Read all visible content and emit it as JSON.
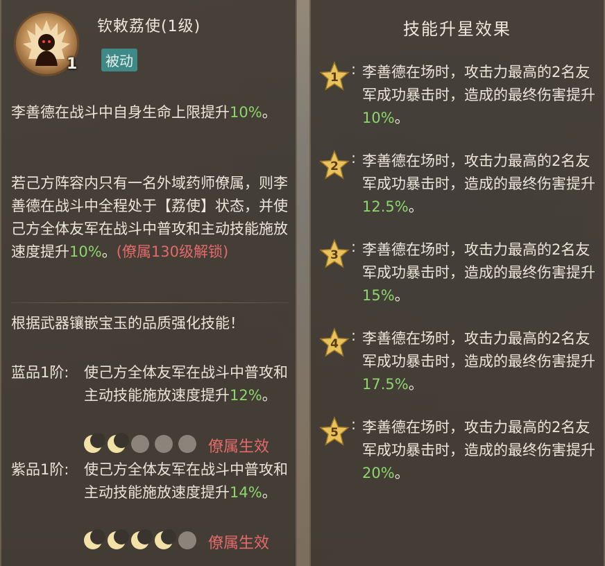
{
  "left_panel": {
    "skill_title": "钦敕荔使(1级)",
    "skill_level_badge": "1",
    "skill_tag": "被动",
    "desc1_prefix": "李善德在战斗中自身生命上限提升",
    "desc1_value": "10%",
    "desc1_suffix": "。",
    "desc2_text": "若己方阵容内只有一名外域药师僚属，则李善德在战斗中全程处于【荔使】状态，并使己方全体友军在战斗中普攻和主动技能施放速度提升",
    "desc2_value": "10%",
    "desc2_suffix": "。",
    "desc2_unlock": "(僚属130级解锁)",
    "gem_header": "根据武器镶嵌宝玉的品质强化技能！",
    "tiers": [
      {
        "name": "蓝品1阶:",
        "text": "使己方全体友军在战斗中普攻和主动技能施放速度提升",
        "value": "12%",
        "suffix": "。",
        "moons_lit": 2,
        "moons_total": 5,
        "status": "僚属生效"
      },
      {
        "name": "紫品1阶:",
        "text": "使己方全体友军在战斗中普攻和主动技能施放速度提升",
        "value": "14%",
        "suffix": "。",
        "moons_lit": 4,
        "moons_total": 5,
        "status": "僚属生效"
      }
    ]
  },
  "right_panel": {
    "title": "技能升星效果",
    "stars": [
      {
        "num": "1",
        "text": "李善德在场时，攻击力最高的2名友军成功暴击时，造成的最终伤害提升",
        "value": "10%",
        "suffix": "。"
      },
      {
        "num": "2",
        "text": "李善德在场时，攻击力最高的2名友军成功暴击时，造成的最终伤害提升",
        "value": "12.5%",
        "suffix": "。"
      },
      {
        "num": "3",
        "text": "李善德在场时，攻击力最高的2名友军成功暴击时，造成的最终伤害提升",
        "value": "15%",
        "suffix": "。"
      },
      {
        "num": "4",
        "text": "李善德在场时，攻击力最高的2名友军成功暴击时，造成的最终伤害提升",
        "value": "17.5%",
        "suffix": "。"
      },
      {
        "num": "5",
        "text": "李善德在场时，攻击力最高的2名友军成功暴击时，造成的最终伤害提升",
        "value": "20%",
        "suffix": "。"
      }
    ],
    "star_colon": ":"
  },
  "colors": {
    "panel_bg": "#3a342f",
    "text": "#ece6da",
    "green_value": "#8cd66c",
    "red_unlock": "#e46a6a",
    "tag_bg": "#3f8a86",
    "star_gold": "#e8c25a"
  },
  "icons": {
    "skill_icon": "flame-figure-icon",
    "moon": "crescent-moon-icon",
    "star": "star-icon"
  }
}
